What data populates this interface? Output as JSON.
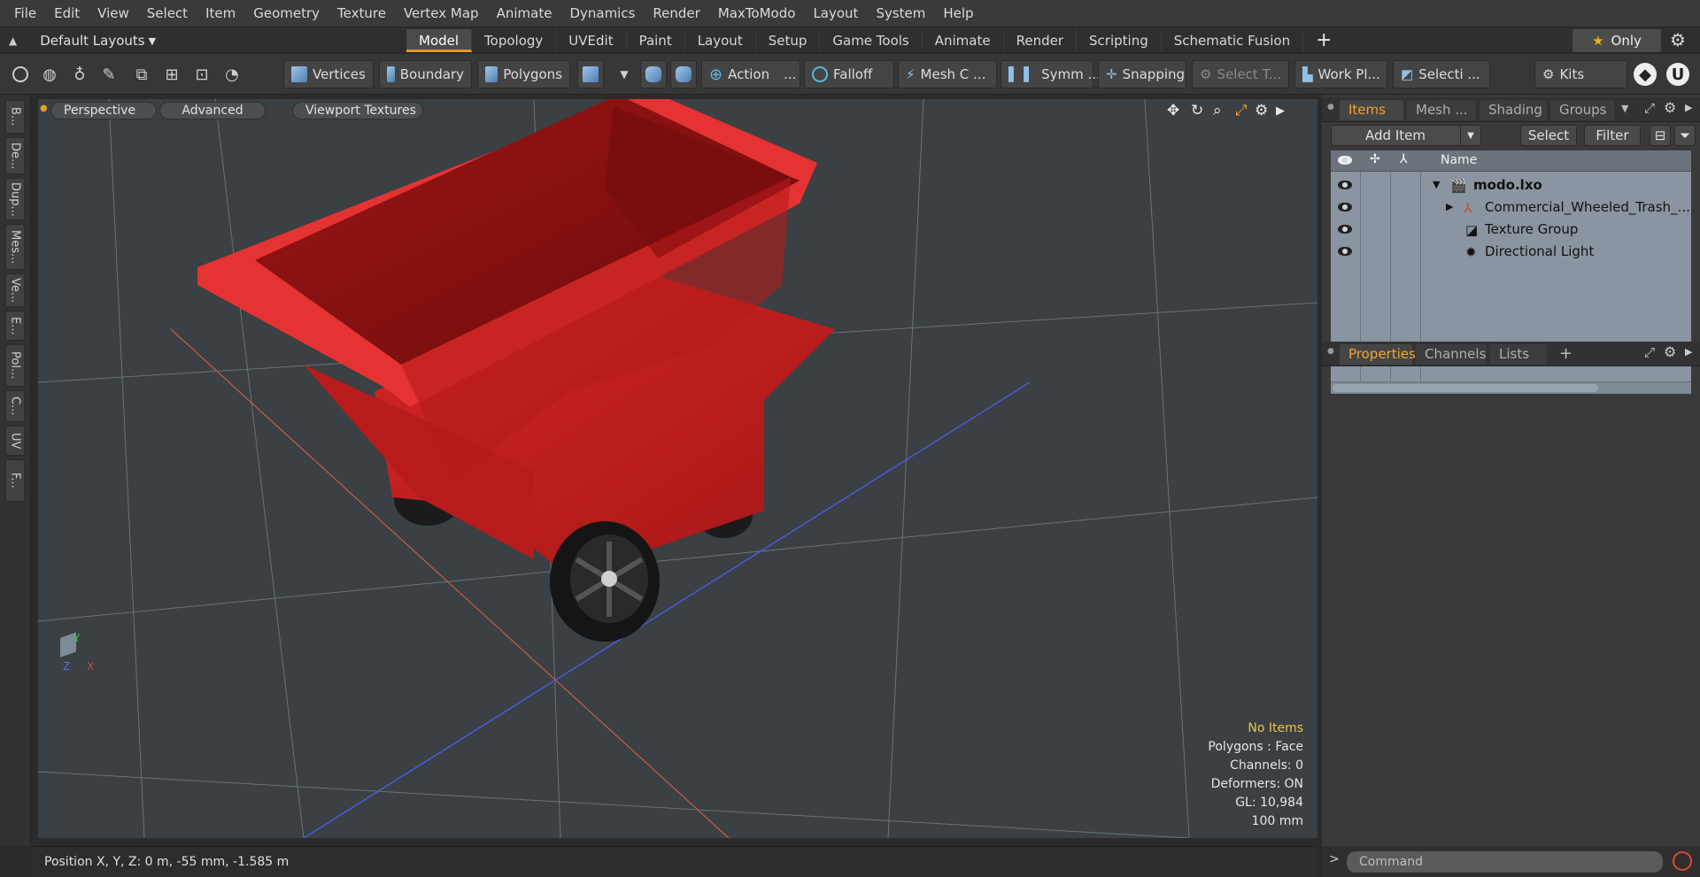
{
  "menu": [
    "File",
    "Edit",
    "View",
    "Select",
    "Item",
    "Geometry",
    "Texture",
    "Vertex Map",
    "Animate",
    "Dynamics",
    "Render",
    "MaxToModo",
    "Layout",
    "System",
    "Help"
  ],
  "layouts": {
    "dropdown_label": "Default Layouts",
    "tabs": [
      "Model",
      "Topology",
      "UVEdit",
      "Paint",
      "Layout",
      "Setup",
      "Game Tools",
      "Animate",
      "Render",
      "Scripting",
      "Schematic Fusion"
    ],
    "active_tab": "Model",
    "only_label": "Only"
  },
  "toolbar": {
    "vertices": "Vertices",
    "boundary": "Boundary",
    "polygons": "Polygons",
    "action": "Action",
    "action_more": "...",
    "falloff": "Falloff",
    "mesh": "Mesh C ...",
    "symm": "Symm ...",
    "snapping": "Snapping",
    "select_t": "Select T...",
    "workplane": "Work Pl...",
    "selection": "Selecti ...",
    "kits": "Kits"
  },
  "left_strip": [
    "B...",
    "De...",
    "Dup...",
    "Mes...",
    "Ve...",
    "E...",
    "Pol...",
    "C...",
    "UV",
    "F..."
  ],
  "viewport": {
    "perspective": "Perspective",
    "advanced": "Advanced",
    "textures": "Viewport Textures",
    "info": {
      "selection": "No Items",
      "polygons": "Polygons : Face",
      "channels": "Channels: 0",
      "deformers": "Deformers: ON",
      "gl": "GL: 10,984",
      "scale": "100 mm"
    },
    "model_colors": {
      "body": "#c81e1e",
      "rim": "#e53030",
      "inner": "#8c1010",
      "wheel": "#1a1a1a"
    }
  },
  "status": {
    "position": "Position X, Y, Z:   0 m, -55 mm, -1.585 m"
  },
  "items_panel": {
    "tabs": [
      "Items",
      "Mesh ...",
      "Shading",
      "Groups"
    ],
    "active_tab": "Items",
    "add_item": "Add Item",
    "select": "Select",
    "filter": "Filter",
    "column_name": "Name",
    "rows": [
      {
        "label": "modo.lxo",
        "bold": true
      },
      {
        "label": "Commercial_Wheeled_Trash_..."
      },
      {
        "label": "Texture Group"
      },
      {
        "label": "Directional Light"
      }
    ]
  },
  "properties_panel": {
    "tabs": [
      "Properties",
      "Channels",
      "Lists"
    ],
    "active_tab": "Properties"
  },
  "command": {
    "placeholder": "Command"
  }
}
